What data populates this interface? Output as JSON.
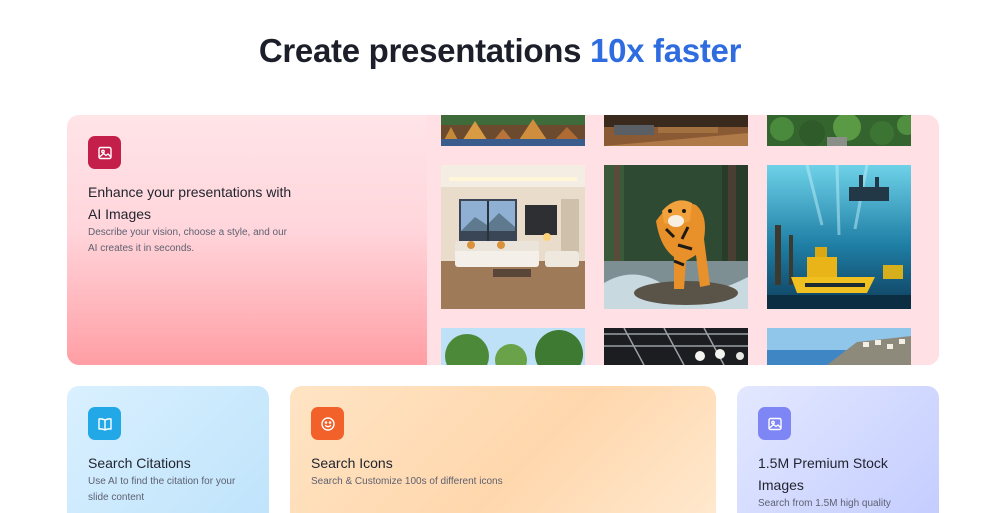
{
  "headline": {
    "main": "Create presentations ",
    "accent": "10x faster"
  },
  "hero": {
    "icon": "image-icon",
    "title": "Enhance your presentations with AI Images",
    "description": "Describe your vision, choose a style, and our AI creates it in seconds."
  },
  "gallery": {
    "images": [
      {
        "name": "temple-city-image"
      },
      {
        "name": "wooden-interior-image"
      },
      {
        "name": "forest-canopy-image"
      },
      {
        "name": "living-room-image"
      },
      {
        "name": "tiger-image"
      },
      {
        "name": "underwater-ship-image"
      },
      {
        "name": "trees-sky-image"
      },
      {
        "name": "industrial-ceiling-image"
      },
      {
        "name": "coastal-town-image"
      }
    ]
  },
  "cards": [
    {
      "icon": "book-icon",
      "title": "Search Citations",
      "description": "Use AI to find the citation for your slide content"
    },
    {
      "icon": "smile-icon",
      "title": "Search Icons",
      "description": "Search & Customize 100s of different icons"
    },
    {
      "icon": "image-icon",
      "title": "1.5M Premium Stock Images",
      "description": "Search from 1.5M high quality"
    }
  ],
  "colors": {
    "accent": "#2f6cdf",
    "hero_icon": "#c41e4a",
    "citations_icon": "#22a8e6",
    "icons_icon": "#f2612a",
    "stock_icon": "#7e85f4"
  }
}
